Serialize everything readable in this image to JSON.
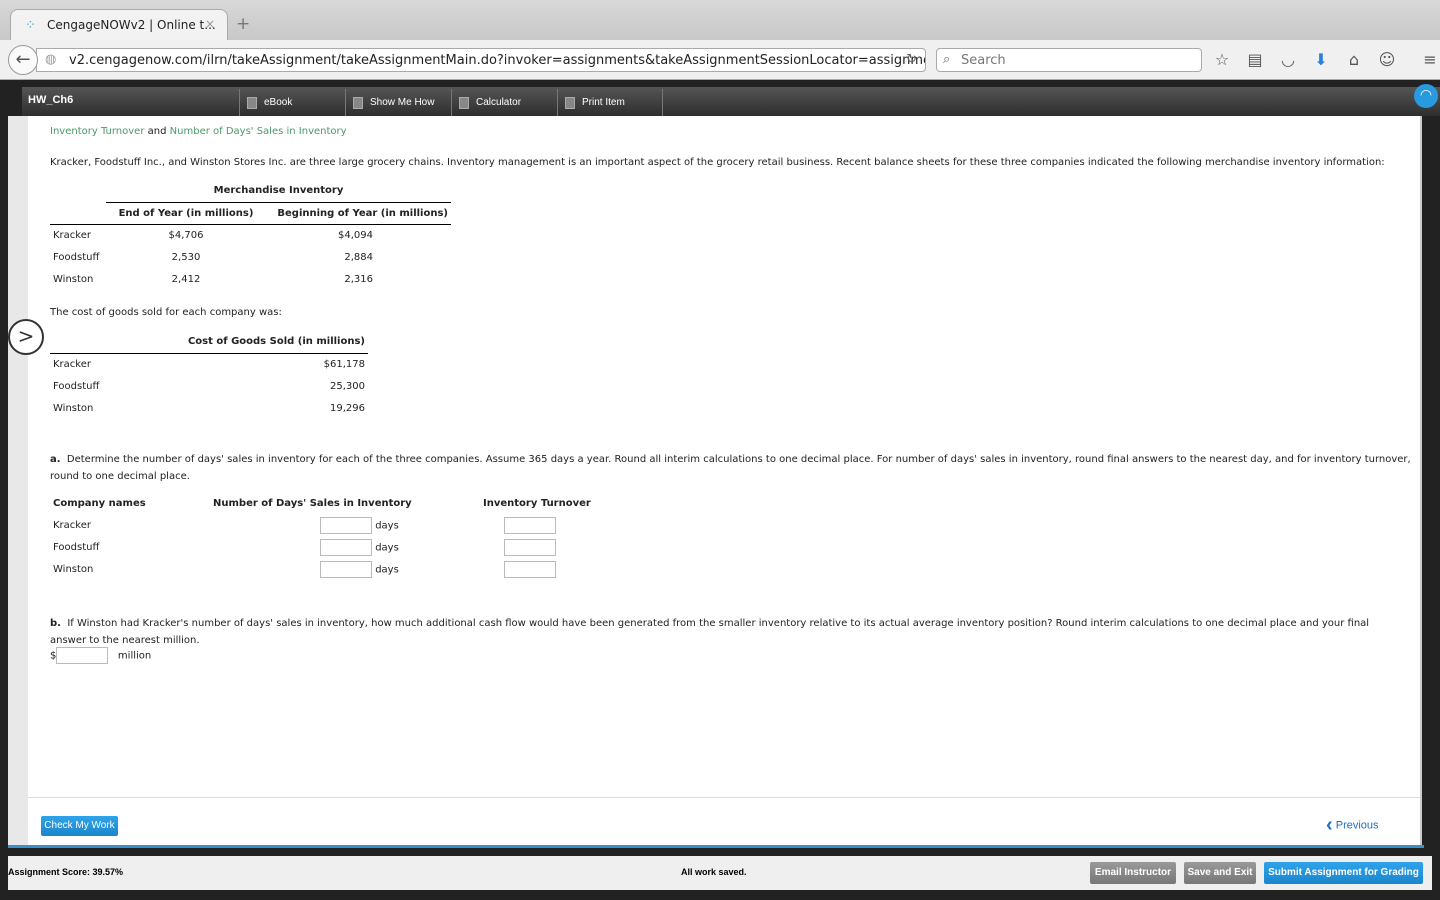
{
  "browser": {
    "tab_title": "CengageNOWv2 | Online t...",
    "url": "v2.cengagenow.com/ilrn/takeAssignment/takeAssignmentMain.do?invoker=assignments&takeAssignmentSessionLocator=assignment-t",
    "search_placeholder": "Search"
  },
  "app": {
    "title": "HW_Ch6",
    "toolbar": [
      "eBook",
      "Show Me How",
      "Calculator",
      "Print Item"
    ]
  },
  "content": {
    "heading_part1": "Inventory Turnover",
    "heading_and": "and",
    "heading_part2": "Number of Days' Sales in Inventory",
    "intro": "Kracker, Foodstuff Inc., and Winston Stores Inc. are three large grocery chains. Inventory management is an important aspect of the grocery retail business. Recent balance sheets for these three companies indicated the following merchandise inventory information:",
    "inv_table": {
      "caption": "Merchandise Inventory",
      "headers": [
        "End of Year (in millions)",
        "Beginning of Year (in millions)"
      ],
      "rows": [
        [
          "Kracker",
          "$4,706",
          "$4,094"
        ],
        [
          "Foodstuff",
          "2,530",
          "2,884"
        ],
        [
          "Winston",
          "2,412",
          "2,316"
        ]
      ]
    },
    "cogs_intro": "The cost of goods sold for each company was:",
    "cogs_table": {
      "header": "Cost of Goods Sold (in millions)",
      "rows": [
        [
          "Kracker",
          "$61,178"
        ],
        [
          "Foodstuff",
          "25,300"
        ],
        [
          "Winston",
          "19,296"
        ]
      ]
    },
    "part_a_label": "a.",
    "part_a": "Determine the number of days' sales in inventory for each of the three companies. Assume 365 days a year. Round all interim calculations to one decimal place. For number of days' sales in inventory, round final answers to the nearest day, and for inventory turnover, round to one decimal place.",
    "answer_table": {
      "headers": [
        "Company names",
        "Number of Days' Sales in Inventory",
        "Inventory Turnover"
      ],
      "unit": "days",
      "rows": [
        "Kracker",
        "Foodstuff",
        "Winston"
      ]
    },
    "part_b_label": "b.",
    "part_b": "If Winston had Kracker's number of days' sales in inventory, how much additional cash flow would have been generated from the smaller inventory relative to its actual average inventory position? Round interim calculations to one decimal place and your final answer to the nearest million.",
    "currency": "$",
    "million": "million"
  },
  "footer": {
    "check": "Check My Work",
    "previous": "Previous",
    "score": "Assignment Score: 39.57%",
    "saved": "All work saved.",
    "email": "Email Instructor",
    "save_exit": "Save and Exit",
    "submit": "Submit Assignment for Grading"
  }
}
